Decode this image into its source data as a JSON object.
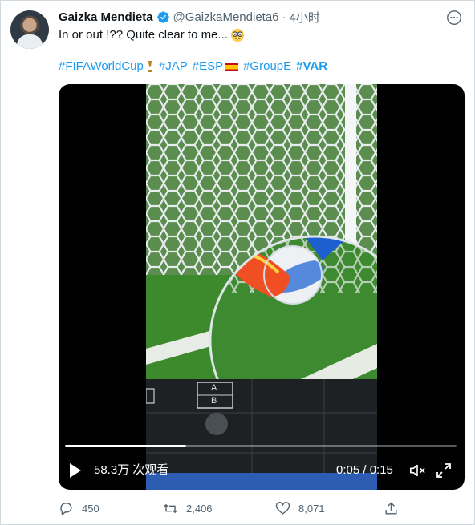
{
  "tweet": {
    "author_name": "Gaizka Mendieta",
    "handle": "@GaizkaMendieta6",
    "separator": "·",
    "time": "4小时",
    "text": "In or out !?? Quite clear to me...",
    "text_emoji": "nerd-face-emoji",
    "hashtags": [
      {
        "label": "#FIFAWorldCup",
        "suffix_icon": "trophy-icon"
      },
      {
        "label": "#JAP"
      },
      {
        "label": "#ESP",
        "suffix_icon": "spain-flag-icon"
      },
      {
        "label": "#GroupE"
      },
      {
        "label": "#VAR",
        "bold": true
      }
    ]
  },
  "video": {
    "views": "58.3万 次观看",
    "elapsed": "0:05",
    "duration": "0:15",
    "time_display": "0:05 / 0:15",
    "progress_fraction": 0.31,
    "frame_text": {
      "box_label_top": "A",
      "box_label_bottom": "B"
    }
  },
  "actions": {
    "replies": "450",
    "retweets": "2,406",
    "likes": "8,071"
  },
  "colors": {
    "link": "#1d9bf0",
    "muted": "#536471",
    "verified": "#1d9bf0"
  }
}
